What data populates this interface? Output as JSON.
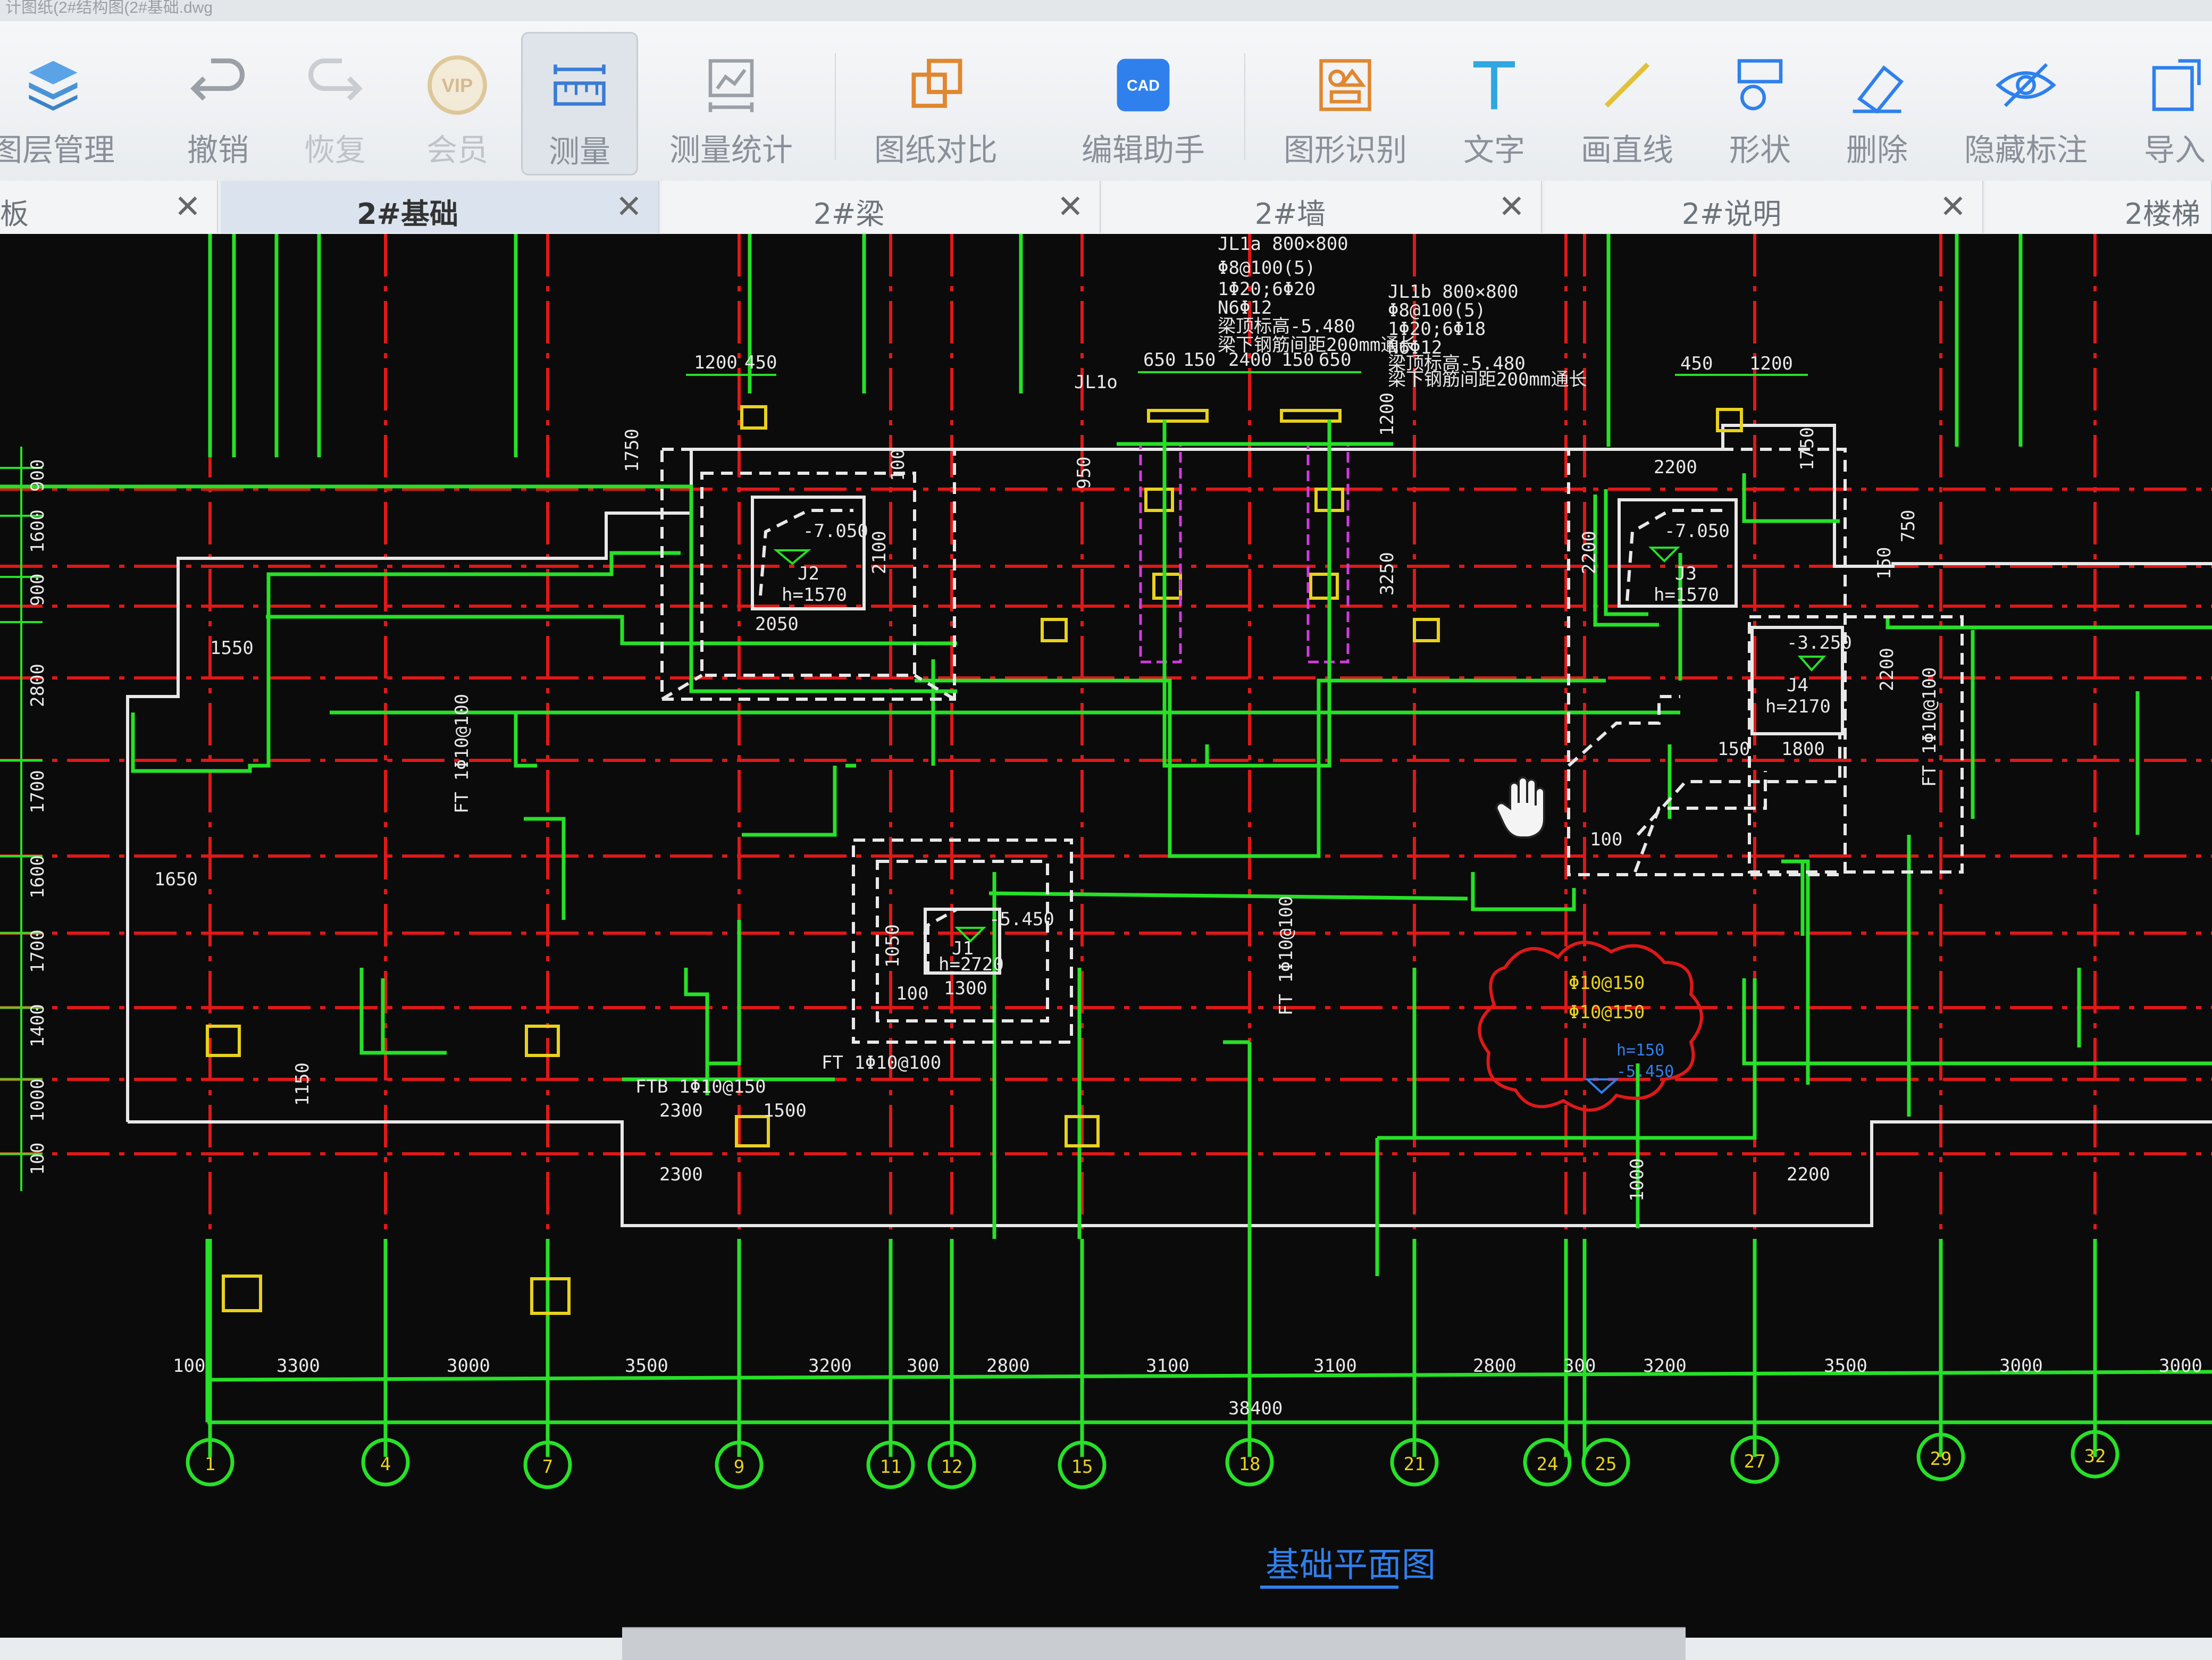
{
  "window": {
    "title": "计图纸(2#结构图(2#基础.dwg"
  },
  "toolbar": [
    {
      "label": "图层管理",
      "icon": "layers-icon"
    },
    {
      "label": "撤销",
      "icon": "undo-icon"
    },
    {
      "label": "恢复",
      "icon": "redo-icon"
    },
    {
      "label": "会员",
      "icon": "vip-icon",
      "badge": "VIP"
    },
    {
      "label": "测量",
      "icon": "measure-ruler-icon"
    },
    {
      "label": "测量统计",
      "icon": "measure-stats-icon"
    },
    {
      "label": "图纸对比",
      "icon": "compare-icon"
    },
    {
      "label": "编辑助手",
      "icon": "cad-edit-icon",
      "badge": "CAD"
    },
    {
      "label": "图形识别",
      "icon": "shape-recognize-icon"
    },
    {
      "label": "文字",
      "icon": "text-icon"
    },
    {
      "label": "画直线",
      "icon": "line-icon"
    },
    {
      "label": "形状",
      "icon": "shape-icon"
    },
    {
      "label": "删除",
      "icon": "eraser-icon"
    },
    {
      "label": "隐藏标注",
      "icon": "hide-eye-icon"
    },
    {
      "label": "导入",
      "icon": "import-icon"
    }
  ],
  "tabs": [
    {
      "label": "板",
      "active": false
    },
    {
      "label": "2#基础",
      "active": true
    },
    {
      "label": "2#梁",
      "active": false
    },
    {
      "label": "2#墙",
      "active": false
    },
    {
      "label": "2#说明",
      "active": false
    },
    {
      "label": "2楼梯",
      "active": false
    }
  ],
  "drawing": {
    "title": "基础平面图",
    "axis_labels": [
      "1",
      "4",
      "7",
      "9",
      "11",
      "12",
      "15",
      "18",
      "21",
      "24",
      "25",
      "27",
      "29",
      "32"
    ],
    "bottom_dims": [
      "100",
      "3300",
      "3000",
      "3500",
      "3200",
      "300",
      "2800",
      "3100",
      "3100",
      "2800",
      "300",
      "3200",
      "3500",
      "3000",
      "3000"
    ],
    "total_dim": "38400",
    "left_dims": [
      "900",
      "1600",
      "900",
      "2800",
      "1700",
      "1600",
      "1700",
      "1400",
      "1000",
      "100"
    ],
    "labels": {
      "jl1": "JL1a 800×800",
      "jl1_lines": [
        "Φ8@100(5)",
        "1Φ20;6Φ20",
        "N6Φ12",
        "梁顶标高-5.480",
        "梁下钢筋间距200mm通长"
      ],
      "jl1b": "JL1b 800×800",
      "jl1b_lines": [
        "Φ8@100(5)",
        "1Φ20;6Φ18",
        "N6Φ12",
        "梁顶标高-5.480",
        "梁下钢筋间距200mm通长"
      ],
      "jl1o": "JL1o",
      "dims_top_left": [
        "1200",
        "450"
      ],
      "dims_top_right": [
        "450",
        "1200"
      ],
      "dims_top_mid": [
        "650",
        "150",
        "2400",
        "150",
        "650"
      ],
      "j2": "J2",
      "j2h": "h=1570",
      "j2lv": "-7.050",
      "j3": "J3",
      "j3h": "h=1570",
      "j3lv": "-7.050",
      "j1": "J1",
      "j1h": "h=2720",
      "j1lv": "-5.450",
      "j4": "J4",
      "j4h": "h=2170",
      "j4lv": "-3.250",
      "ft1": "FT 1Φ10@100",
      "ft2": "FT 1Φ10@100",
      "ft3": "FT 1Φ10@100",
      "ft4": "FT 1Φ10@100",
      "ftb": "FTB 1Φ10@150",
      "cloud_lines": [
        "Φ10@150",
        "Φ10@150",
        "h=150",
        "-5.450"
      ],
      "dim_1550": "1550",
      "dim_1650": "1650",
      "dim_1150": "1150",
      "dim_2300": "2300",
      "dim_1500": "1500",
      "dim_2200": "2200",
      "dim_2050": "2050",
      "dim_1300": "1300",
      "dim_1800": "1800",
      "dim_1050": "1050",
      "dim_100": "100",
      "dim_1750": "1750",
      "dim_950": "950",
      "dim_3250": "3250",
      "dim_750": "750",
      "dim_1000": "1000"
    }
  }
}
